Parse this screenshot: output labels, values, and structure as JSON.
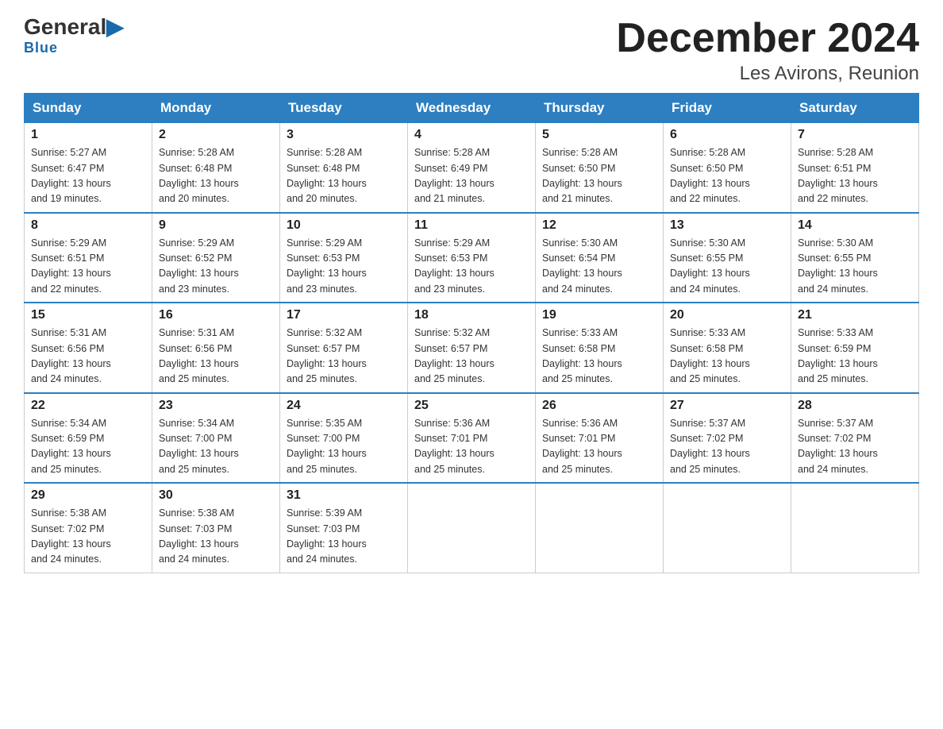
{
  "header": {
    "logo_general": "General",
    "logo_blue": "Blue",
    "month_title": "December 2024",
    "location": "Les Avirons, Reunion"
  },
  "days_of_week": [
    "Sunday",
    "Monday",
    "Tuesday",
    "Wednesday",
    "Thursday",
    "Friday",
    "Saturday"
  ],
  "weeks": [
    [
      {
        "day": "1",
        "sunrise": "5:27 AM",
        "sunset": "6:47 PM",
        "daylight": "13 hours and 19 minutes."
      },
      {
        "day": "2",
        "sunrise": "5:28 AM",
        "sunset": "6:48 PM",
        "daylight": "13 hours and 20 minutes."
      },
      {
        "day": "3",
        "sunrise": "5:28 AM",
        "sunset": "6:48 PM",
        "daylight": "13 hours and 20 minutes."
      },
      {
        "day": "4",
        "sunrise": "5:28 AM",
        "sunset": "6:49 PM",
        "daylight": "13 hours and 21 minutes."
      },
      {
        "day": "5",
        "sunrise": "5:28 AM",
        "sunset": "6:50 PM",
        "daylight": "13 hours and 21 minutes."
      },
      {
        "day": "6",
        "sunrise": "5:28 AM",
        "sunset": "6:50 PM",
        "daylight": "13 hours and 22 minutes."
      },
      {
        "day": "7",
        "sunrise": "5:28 AM",
        "sunset": "6:51 PM",
        "daylight": "13 hours and 22 minutes."
      }
    ],
    [
      {
        "day": "8",
        "sunrise": "5:29 AM",
        "sunset": "6:51 PM",
        "daylight": "13 hours and 22 minutes."
      },
      {
        "day": "9",
        "sunrise": "5:29 AM",
        "sunset": "6:52 PM",
        "daylight": "13 hours and 23 minutes."
      },
      {
        "day": "10",
        "sunrise": "5:29 AM",
        "sunset": "6:53 PM",
        "daylight": "13 hours and 23 minutes."
      },
      {
        "day": "11",
        "sunrise": "5:29 AM",
        "sunset": "6:53 PM",
        "daylight": "13 hours and 23 minutes."
      },
      {
        "day": "12",
        "sunrise": "5:30 AM",
        "sunset": "6:54 PM",
        "daylight": "13 hours and 24 minutes."
      },
      {
        "day": "13",
        "sunrise": "5:30 AM",
        "sunset": "6:55 PM",
        "daylight": "13 hours and 24 minutes."
      },
      {
        "day": "14",
        "sunrise": "5:30 AM",
        "sunset": "6:55 PM",
        "daylight": "13 hours and 24 minutes."
      }
    ],
    [
      {
        "day": "15",
        "sunrise": "5:31 AM",
        "sunset": "6:56 PM",
        "daylight": "13 hours and 24 minutes."
      },
      {
        "day": "16",
        "sunrise": "5:31 AM",
        "sunset": "6:56 PM",
        "daylight": "13 hours and 25 minutes."
      },
      {
        "day": "17",
        "sunrise": "5:32 AM",
        "sunset": "6:57 PM",
        "daylight": "13 hours and 25 minutes."
      },
      {
        "day": "18",
        "sunrise": "5:32 AM",
        "sunset": "6:57 PM",
        "daylight": "13 hours and 25 minutes."
      },
      {
        "day": "19",
        "sunrise": "5:33 AM",
        "sunset": "6:58 PM",
        "daylight": "13 hours and 25 minutes."
      },
      {
        "day": "20",
        "sunrise": "5:33 AM",
        "sunset": "6:58 PM",
        "daylight": "13 hours and 25 minutes."
      },
      {
        "day": "21",
        "sunrise": "5:33 AM",
        "sunset": "6:59 PM",
        "daylight": "13 hours and 25 minutes."
      }
    ],
    [
      {
        "day": "22",
        "sunrise": "5:34 AM",
        "sunset": "6:59 PM",
        "daylight": "13 hours and 25 minutes."
      },
      {
        "day": "23",
        "sunrise": "5:34 AM",
        "sunset": "7:00 PM",
        "daylight": "13 hours and 25 minutes."
      },
      {
        "day": "24",
        "sunrise": "5:35 AM",
        "sunset": "7:00 PM",
        "daylight": "13 hours and 25 minutes."
      },
      {
        "day": "25",
        "sunrise": "5:36 AM",
        "sunset": "7:01 PM",
        "daylight": "13 hours and 25 minutes."
      },
      {
        "day": "26",
        "sunrise": "5:36 AM",
        "sunset": "7:01 PM",
        "daylight": "13 hours and 25 minutes."
      },
      {
        "day": "27",
        "sunrise": "5:37 AM",
        "sunset": "7:02 PM",
        "daylight": "13 hours and 25 minutes."
      },
      {
        "day": "28",
        "sunrise": "5:37 AM",
        "sunset": "7:02 PM",
        "daylight": "13 hours and 24 minutes."
      }
    ],
    [
      {
        "day": "29",
        "sunrise": "5:38 AM",
        "sunset": "7:02 PM",
        "daylight": "13 hours and 24 minutes."
      },
      {
        "day": "30",
        "sunrise": "5:38 AM",
        "sunset": "7:03 PM",
        "daylight": "13 hours and 24 minutes."
      },
      {
        "day": "31",
        "sunrise": "5:39 AM",
        "sunset": "7:03 PM",
        "daylight": "13 hours and 24 minutes."
      },
      null,
      null,
      null,
      null
    ]
  ]
}
